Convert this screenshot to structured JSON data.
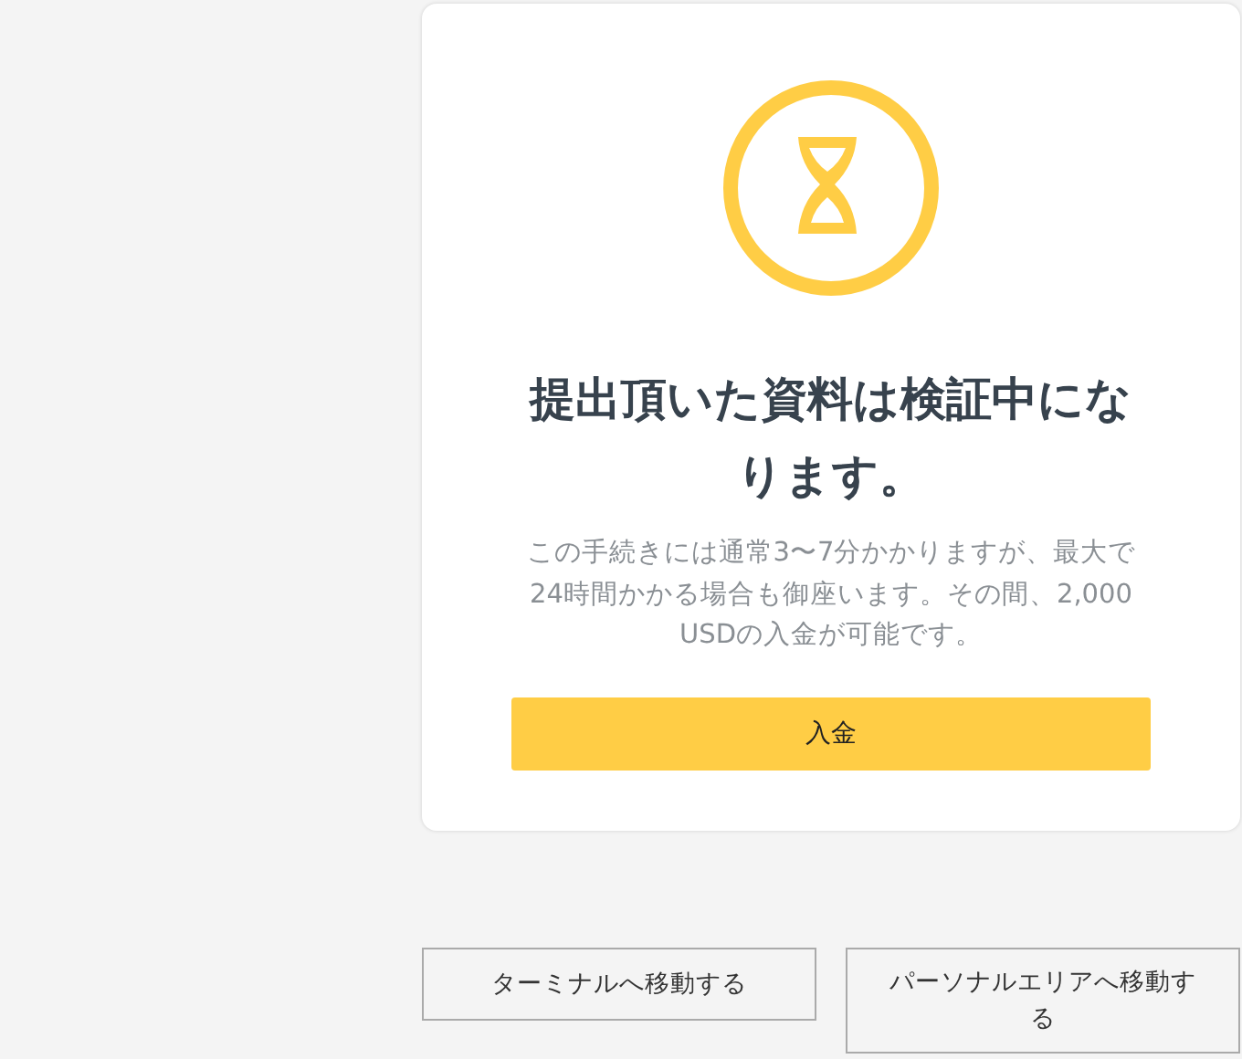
{
  "card": {
    "title": "提出頂いた資料は検証中になります。",
    "message": "この手続きには通常3〜7分かかりますが、最大で24時間かかる場合も御座います。その間、2,000 USDの入金が可能です。",
    "button": "入金"
  },
  "buttons": [
    "ターミナルへ移動する",
    "パーソナルエリアへ移動する"
  ]
}
